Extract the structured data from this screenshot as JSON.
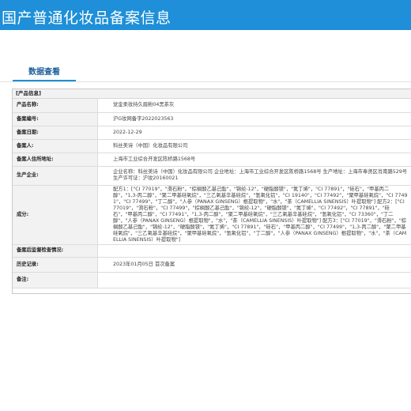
{
  "header": {
    "title": "国产普通化妆品备案信息"
  },
  "tabs": [
    {
      "label": "数据查看",
      "active": true
    }
  ],
  "colors": {
    "brand": "#1e8fd8",
    "tab_text": "#1e5e9c",
    "label_bg": "#f2f2f2"
  },
  "section": {
    "title": "[产品信息]"
  },
  "fields": [
    {
      "label": "产品名称:",
      "value": "觉金柔妆持久眉粉04黑茶灰"
    },
    {
      "label": "备案编号:",
      "value": "沪G妆网备字2022023563"
    },
    {
      "label": "备案日期:",
      "value": "2022-12-29"
    },
    {
      "label": "备案人:",
      "value": "科丝美诗（中国）化妆品有限公司"
    },
    {
      "label": "备案人住所地址:",
      "value": "上海市工业综合开发区陈桥路1568号"
    },
    {
      "label": "生产企业:",
      "value": "企业名称：科丝美诗（中国）化妆品有限公司 企业地址：上海市工业综合开发区陈桥路1568号 生产地址：上海市奉贤区肖南路529号 生产许可证：沪妆20160021"
    },
    {
      "label": "成分:",
      "value": "配方1：[\"CI 77019\"，\"滑石粉\"，\"棕榈酸乙基己酯\"，\"锦纶-12\"，\"硬脂酸镁\"，\"氮丁烯\"，\"CI 77891\"，\"硅石\"，\"甲基丙二醇\"，\"1,3-丙二醇\"，\"聚二甲基硅氧烷\"，\"三乙氧基辛基硅烷\"，\"氢氧化铝\"，\"CI 19140\"，\"CI 77492\"，\"聚甲基硅氧烷\"，\"CI 77491\"，\"CI 77499\"，\"丁二醇\"，\"人参（PANAX GINSENG）根提取物\"，\"水\"，\"茶（CAMELLIA SINENSIS）叶提取物\"] 配方2：[\"CI 77019\"，\"滑石粉\"，\"CI 77499\"，\"棕榈酸乙基己酯\"，\"锦纶-12\"，\"硬脂酸镁\"，\"氮丁烯\"，\"CI 77492\"，\"CI 77891\"，\"硅石\"，\"甲基丙二醇\"，\"CI 77491\"，\"1,3-丙二醇\"，\"聚二甲基硅氧烷\"，\"三乙氧基辛基硅烷\"，\"氢氧化铝\"，\"CI 73360\"，\"丁二醇\"，\"人参（PANAX GINSENG）根提取物\"，\"水\"，\"茶（CAMELLIA SINENSIS）叶提取物\"] 配方3：[\"CI 77019\"，\"滑石粉\"，\"棕榈酸乙基己酯\"，\"锦纶-12\"，\"硬脂酸镁\"，\"氮丁烯\"，\"CI 77891\"，\"硅石\"，\"甲基丙二醇\"，\"CI 77499\"，\"1,3-丙二醇\"，\"聚二甲基硅氧烷\"，\"三乙氧基辛基硅烷\"，\"聚甲基硅氧烷\"，\"氢氧化铝\"，\"丁二醇\"，\"人参（PANAX GINSENG）根提取物\"，\"水\"，\"茶（CAMELLIA SINENSIS）叶提取物\"]"
    },
    {
      "label": "备案后监督检查情况:",
      "value": ""
    },
    {
      "label": "历史记录:",
      "value": "2023年01月05日 首次备案"
    },
    {
      "label": "备注:",
      "value": ""
    }
  ]
}
